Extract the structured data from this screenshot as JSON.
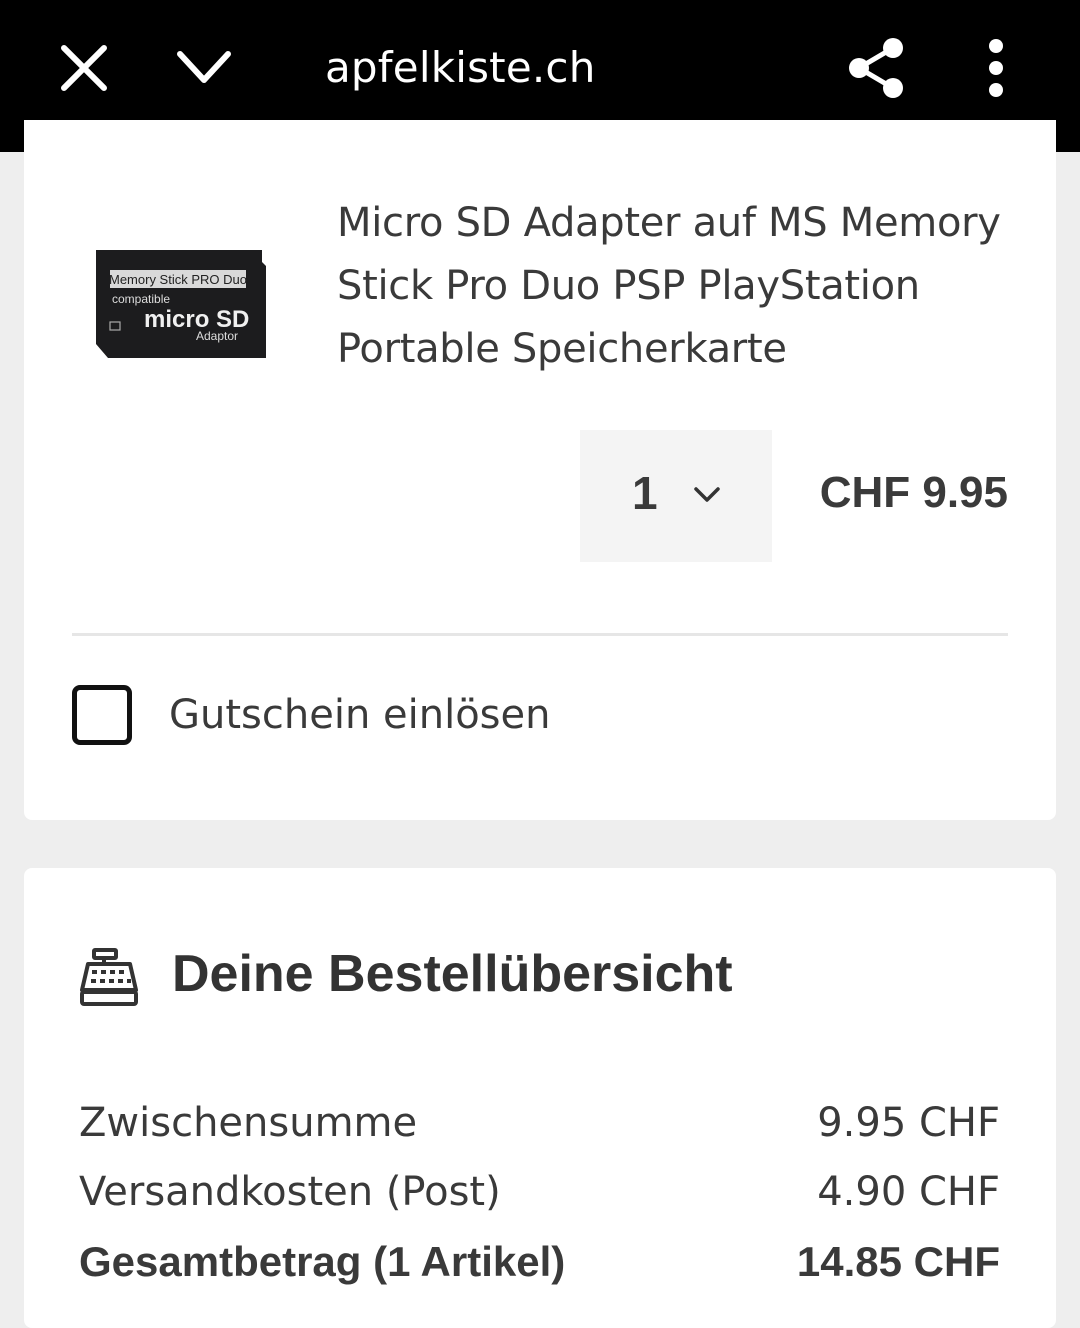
{
  "browser": {
    "domain": "apfelkiste.ch",
    "icons": [
      "close-icon",
      "chevron-down-icon",
      "share-icon",
      "more-vert-icon"
    ]
  },
  "cart_item": {
    "title_lines": [
      "Micro SD Adapter auf MS Memory",
      "Stick Pro Duo PSP PlayStation",
      "Portable Speicherkarte"
    ],
    "image": {
      "label_top": "Memory Stick PRO Duo",
      "label_compat": "compatible",
      "label_main": "micro SD",
      "label_sub": "Adaptor"
    },
    "quantity": "1",
    "price": "CHF 9.95"
  },
  "voucher": {
    "label": "Gutschein einlösen",
    "checked": false
  },
  "summary": {
    "title": "Deine Bestellübersicht",
    "rows": [
      {
        "label": "Zwischensumme",
        "value": "9.95 CHF"
      },
      {
        "label": "Versandkosten (Post)",
        "value": "4.90 CHF"
      },
      {
        "label": "Gesamtbetrag (1 Artikel)",
        "value": "14.85 CHF"
      }
    ]
  },
  "colors": {
    "topbar": "#000000",
    "background": "#eeeeee",
    "card": "#ffffff",
    "text": "#3a3a3a"
  }
}
